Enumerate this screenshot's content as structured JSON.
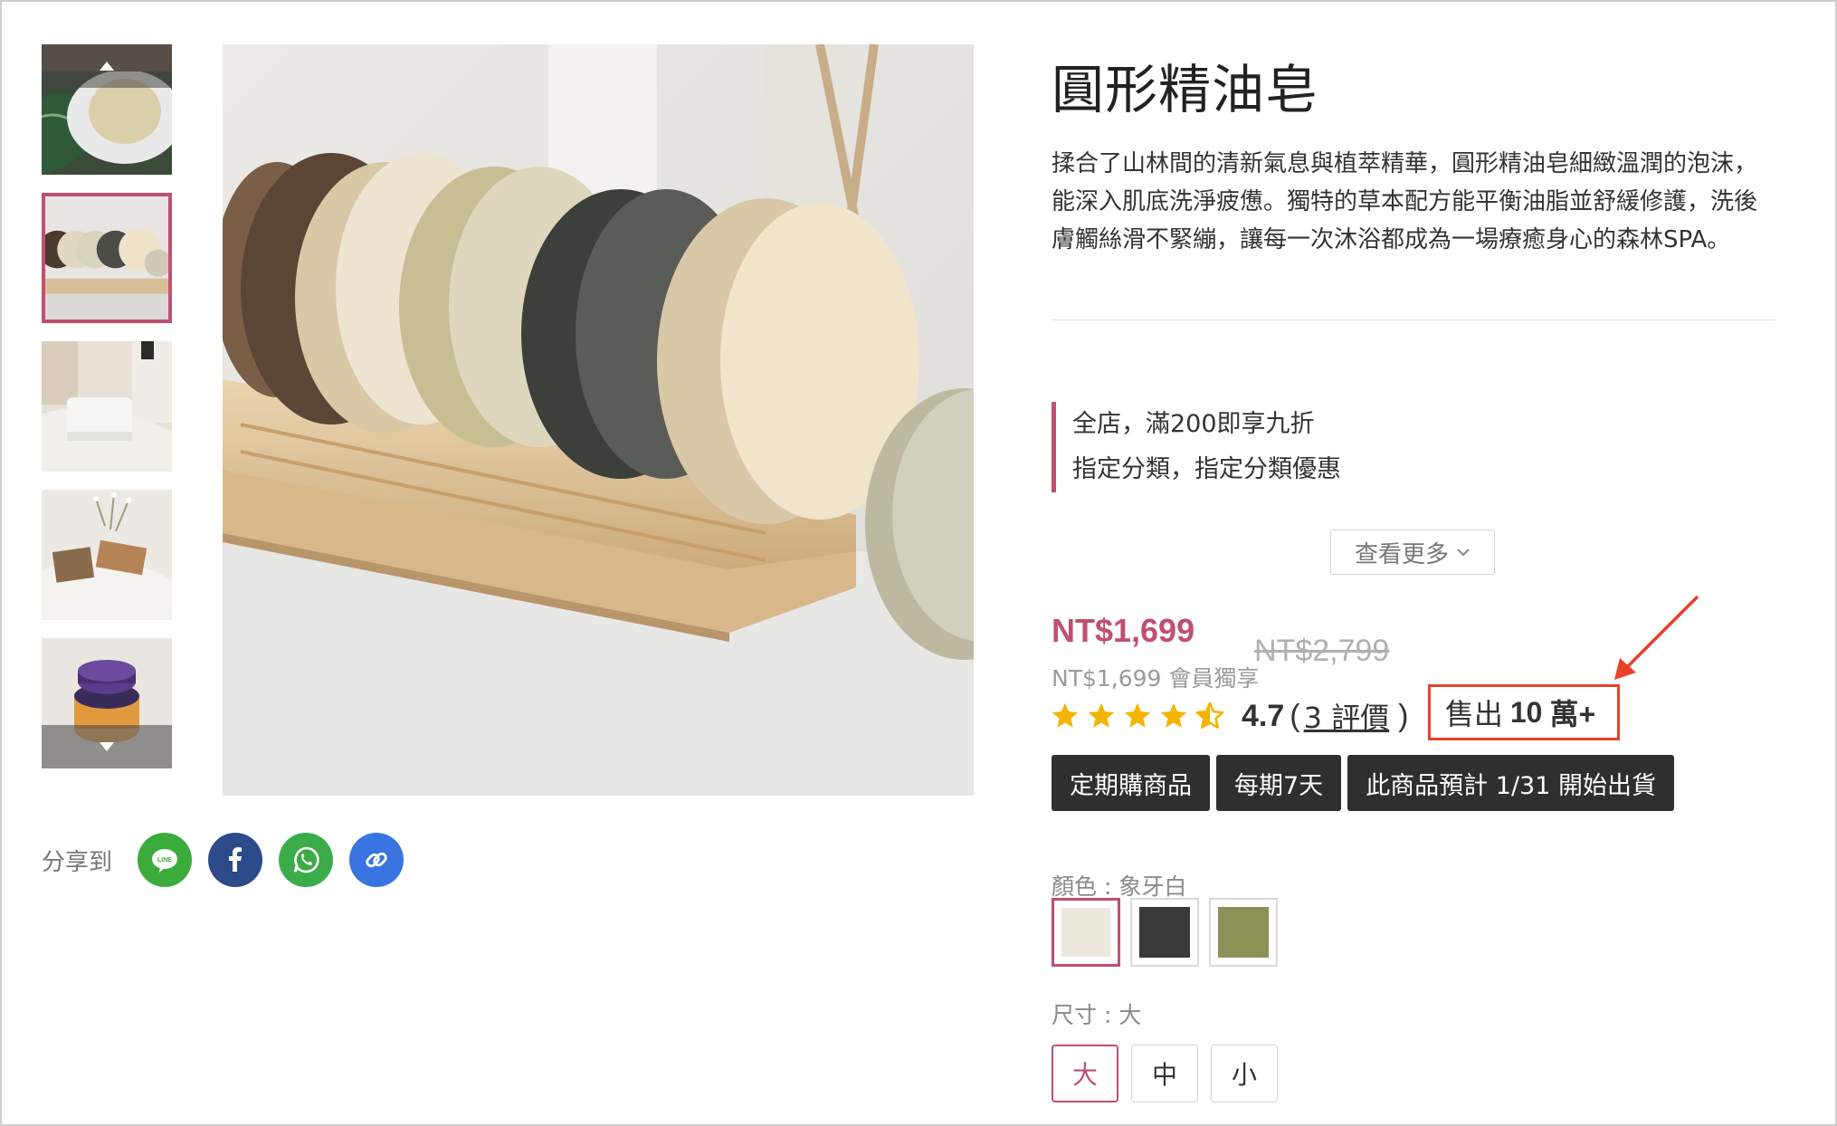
{
  "product": {
    "title": "圓形精油皂",
    "description": "揉合了山林間的清新氣息與植萃精華，圓形精油皂細緻溫潤的泡沫，能深入肌底洗淨疲憊。獨特的草本配方能平衡油脂並舒緩修護，洗後膚觸絲滑不緊繃，讓每一次沐浴都成為一場療癒身心的森林SPA。"
  },
  "promotions": [
    "全店，滿200即享九折",
    "指定分類，指定分類優惠"
  ],
  "see_more_label": "查看更多",
  "pricing": {
    "price": "NT$1,699",
    "original_price": "NT$2,799",
    "member_price": "NT$1,699 會員獨享"
  },
  "rating": {
    "stars": 4.5,
    "score": "4.7",
    "open_paren": "(",
    "review_count_label": "3 評價",
    "close_paren": ")"
  },
  "sold": {
    "prefix": "售出",
    "count": "10",
    "suffix": "萬+"
  },
  "tags": [
    "定期購商品",
    "每期7天",
    "此商品預計 1/31 開始出貨"
  ],
  "color_option": {
    "label": "顏色 : 象牙白",
    "swatches": [
      {
        "name": "象牙白",
        "color": "#ece8de",
        "selected": true
      },
      {
        "name": "dark",
        "color": "#3a3a38",
        "selected": false
      },
      {
        "name": "olive",
        "color": "#8d9158",
        "selected": false
      }
    ]
  },
  "size_option": {
    "label": "尺寸 : 大",
    "sizes": [
      {
        "label": "大",
        "selected": true
      },
      {
        "label": "中",
        "selected": false
      },
      {
        "label": "小",
        "selected": false
      }
    ]
  },
  "share": {
    "label": "分享到",
    "line_text": "LINE",
    "buttons": [
      {
        "icon": "line-icon",
        "color": "#3bab3b"
      },
      {
        "icon": "facebook-icon",
        "color": "#2d4a8a"
      },
      {
        "icon": "whatsapp-icon",
        "color": "#3cab4a"
      },
      {
        "icon": "link-icon",
        "color": "#3a74e0"
      }
    ]
  },
  "colors": {
    "accent": "#c0506f",
    "annotation": "#e8412c",
    "star": "#f5b400",
    "tag_bg": "#2f2f2f"
  }
}
